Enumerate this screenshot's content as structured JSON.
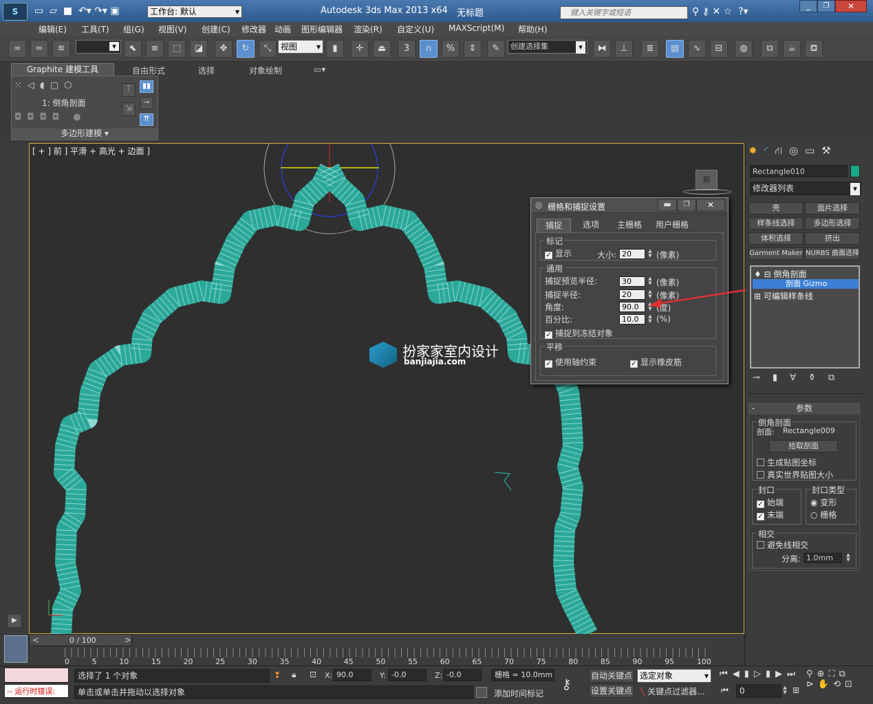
{
  "app": {
    "title": "Autodesk 3ds Max  2013 x64",
    "doc_title": "无标题",
    "workspace": "工作台: 默认",
    "search_placeholder": "键入关键字或短语"
  },
  "menu": [
    "编辑(E)",
    "工具(T)",
    "组(G)",
    "视图(V)",
    "创建(C)",
    "修改器",
    "动画",
    "图形编辑器",
    "渲染(R)",
    "自定义(U)",
    "MAXScript(M)",
    "帮助(H)"
  ],
  "toolbar": {
    "ref_coord": "视图",
    "named_sel": "创建选择集",
    "snap_3": "3",
    "percent": "%"
  },
  "ribbon": {
    "tabs": [
      "Graphite 建模工具",
      "自由形式",
      "选择",
      "对象绘制"
    ],
    "selection_label": "1: 倒角剖面",
    "panel_label": "多边形建模"
  },
  "viewport": {
    "label": "[ + ] 前 ] 平滑 + 高光 + 边面 ]",
    "watermark_title": "扮家家室内设计",
    "watermark_url": "banjiajia.com",
    "viewcube": "前"
  },
  "dialog": {
    "title": "栅格和捕捉设置",
    "tabs": [
      "捕捉",
      "选项",
      "主栅格",
      "用户栅格"
    ],
    "markers": {
      "group": "标记",
      "display": "显示",
      "size_label": "大小:",
      "size": "20",
      "unit": "(像素)"
    },
    "general": {
      "group": "通用",
      "preview_radius_label": "捕捉预览半径:",
      "preview_radius": "30",
      "snap_radius_label": "捕捉半径:",
      "snap_radius": "20",
      "angle_label": "角度:",
      "angle": "90.0",
      "angle_unit": "(度)",
      "percent_label": "百分比:",
      "percent": "10.0",
      "percent_unit": "(%)",
      "px_unit1": "(像素)",
      "px_unit2": "(像素)",
      "frozen": "捕捉到冻结对象"
    },
    "translation": {
      "group": "平移",
      "axis_constraint": "使用轴约束",
      "rubber_band": "显示橡皮筋"
    }
  },
  "cmdpanel": {
    "object_name": "Rectangle010",
    "object_color": "#1aa88a",
    "modifier_list": "修改器列表",
    "buttons": [
      "壳",
      "面片选择",
      "样条线选择",
      "多边形选择",
      "体积选择",
      "挤出",
      "Garment Maker",
      "NURBS 曲面选择"
    ],
    "stack": [
      "倒角剖面",
      "剖面 Gizmo",
      "可编辑样条线"
    ],
    "params": {
      "rollout": "参数",
      "bevel_group": "倒角剖面",
      "profile_label": "剖面:",
      "profile_value": "Rectangle009",
      "pick_profile": "拾取剖面",
      "gen_map": "生成贴图坐标",
      "real_world": "真实世界贴图大小",
      "cap_group": "封口",
      "cap_start": "始端",
      "cap_end": "末端",
      "cap_type_group": "封口类型",
      "morph": "变形",
      "grid": "栅格",
      "intersect_group": "相交",
      "avoid": "避免线相交",
      "sep_label": "分离:",
      "sep_value": "1.0mm"
    }
  },
  "timeline": {
    "frame": "0 / 100",
    "ticks": [
      "0",
      "5",
      "10",
      "15",
      "20",
      "25",
      "30",
      "35",
      "40",
      "45",
      "50",
      "55",
      "60",
      "65",
      "70",
      "75",
      "80",
      "85",
      "90",
      "95",
      "100"
    ]
  },
  "status": {
    "error": "-- 运行时错误:",
    "selected": "选择了 1 个对象",
    "hint": "单击或单击并拖动以选择对象",
    "x_label": "X:",
    "x": "90.0",
    "y_label": "Y:",
    "y": "-0.0",
    "z_label": "Z:",
    "z": "-0.0",
    "grid": "栅格 = 10.0mm",
    "add_time_tag": "添加时间标记",
    "auto_key": "自动关键点",
    "set_key": "设置关键点",
    "selected_dropdown": "选定对象",
    "key_filters": "关键点过滤器...",
    "frame_field": "0"
  }
}
